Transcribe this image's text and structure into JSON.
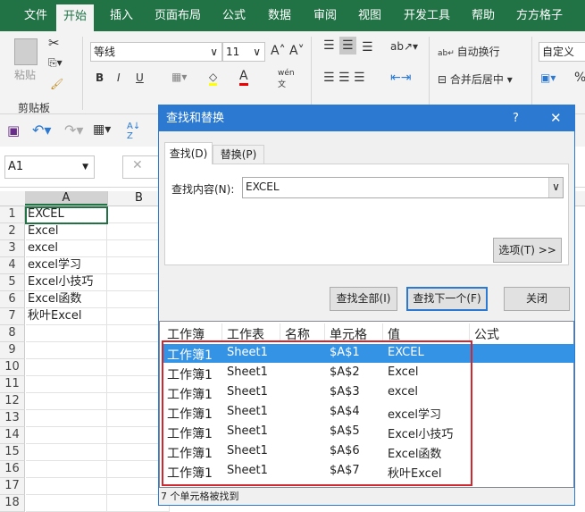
{
  "ribbon_tabs": [
    "文件",
    "开始",
    "插入",
    "页面布局",
    "公式",
    "数据",
    "审阅",
    "视图",
    "开发工具",
    "帮助",
    "方方格子"
  ],
  "active_tab": "开始",
  "ribbon": {
    "paste": "粘贴",
    "clipboard_group": "剪贴板",
    "font_name": "等线",
    "font_size": "11",
    "wrap_text": "自动换行",
    "merge_center": "合并后居中",
    "number_format": "自定义",
    "bold": "B",
    "italic": "I",
    "underline": "U",
    "percent": "%"
  },
  "name_box": "A1",
  "columns": [
    "A",
    "B"
  ],
  "rows": [
    "1",
    "2",
    "3",
    "4",
    "5",
    "6",
    "7",
    "8",
    "9",
    "10",
    "11",
    "12",
    "13",
    "14",
    "15",
    "16",
    "17",
    "18"
  ],
  "cells": [
    "EXCEL",
    "Excel",
    "excel",
    "excel学习",
    "Excel小技巧",
    "Excel函数",
    "秋叶Excel"
  ],
  "dialog": {
    "title": "查找和替换",
    "help": "?",
    "close": "✕",
    "tabs": [
      "查找(D)",
      "替换(P)"
    ],
    "find_label": "查找内容(N):",
    "find_value": "EXCEL",
    "options_button": "选项(T) >>",
    "find_all": "查找全部(I)",
    "find_next": "查找下一个(F)",
    "close_button": "关闭",
    "headers": [
      "工作簿",
      "工作表",
      "名称",
      "单元格",
      "值",
      "公式"
    ],
    "results": [
      [
        "工作簿1",
        "Sheet1",
        "",
        "$A$1",
        "EXCEL",
        ""
      ],
      [
        "工作簿1",
        "Sheet1",
        "",
        "$A$2",
        "Excel",
        ""
      ],
      [
        "工作簿1",
        "Sheet1",
        "",
        "$A$3",
        "excel",
        ""
      ],
      [
        "工作簿1",
        "Sheet1",
        "",
        "$A$4",
        "excel学习",
        ""
      ],
      [
        "工作簿1",
        "Sheet1",
        "",
        "$A$5",
        "Excel小技巧",
        ""
      ],
      [
        "工作簿1",
        "Sheet1",
        "",
        "$A$6",
        "Excel函数",
        ""
      ],
      [
        "工作簿1",
        "Sheet1",
        "",
        "$A$7",
        "秋叶Excel",
        ""
      ]
    ],
    "status": "7 个单元格被找到"
  },
  "colors": {
    "excel_green": "#217346",
    "dialog_blue": "#2b79d0",
    "selection": "#3593e6",
    "highlight_box": "#d0282e"
  }
}
